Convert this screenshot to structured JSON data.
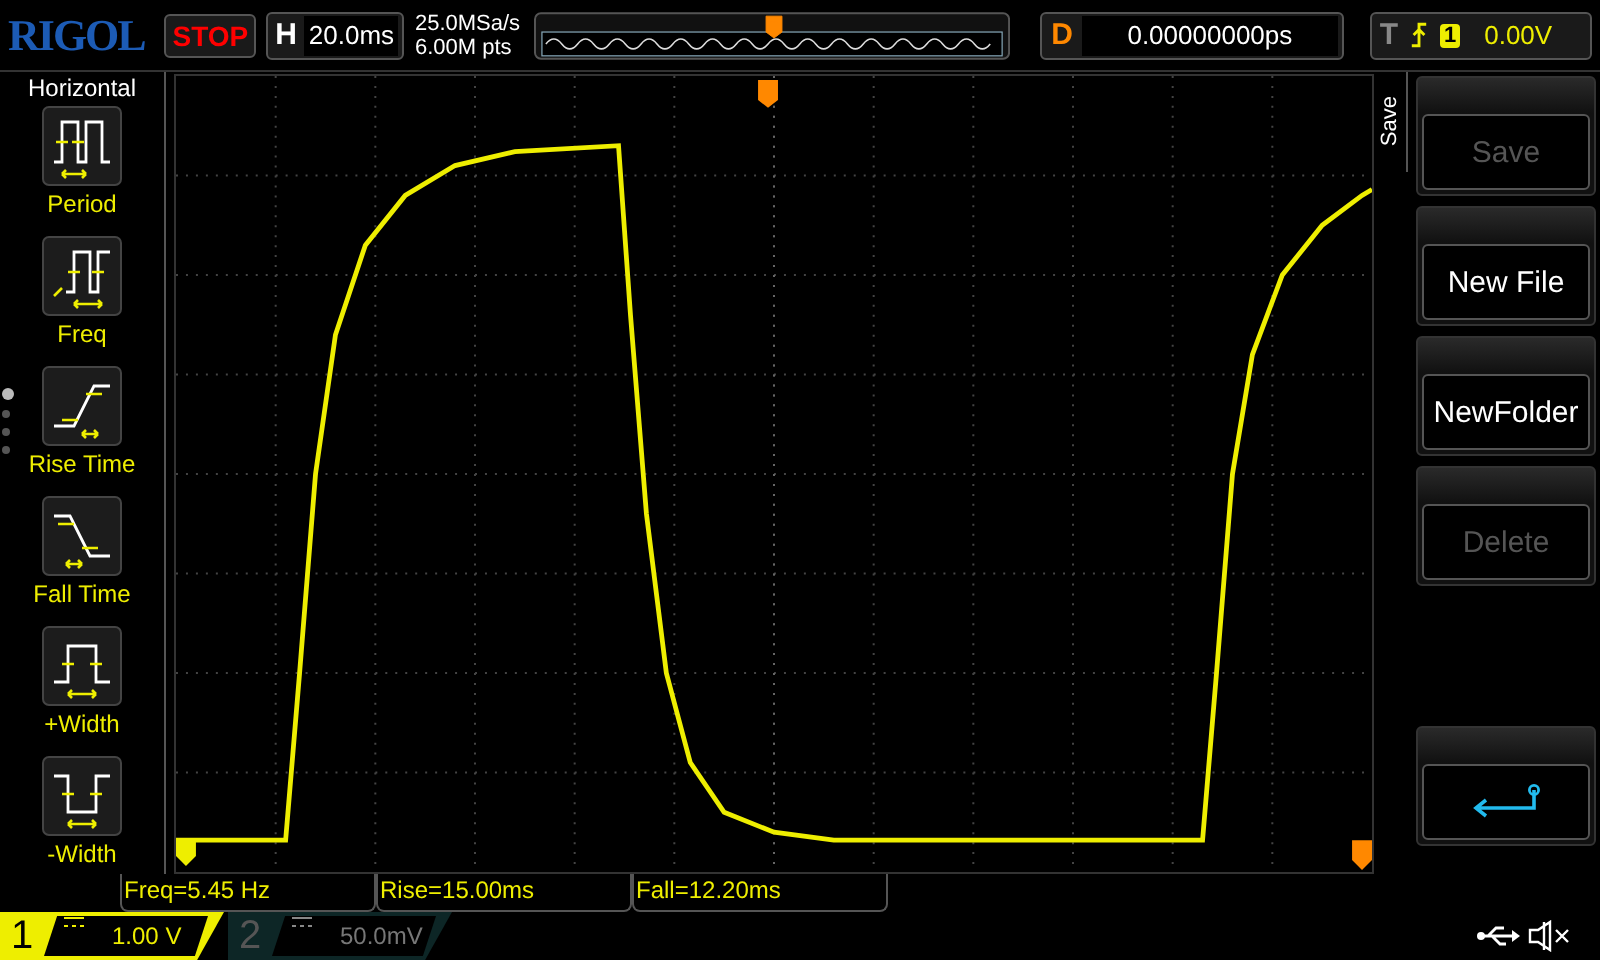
{
  "brand": "RIGOL",
  "run_state": {
    "label": "STOP",
    "running": false
  },
  "horizontal": {
    "label": "H",
    "timebase": "20.0ms"
  },
  "acquisition": {
    "sample_rate": "25.0MSa/s",
    "memory_depth": "6.00M pts"
  },
  "delay": {
    "label": "D",
    "value": "0.00000000ps"
  },
  "trigger": {
    "label": "T",
    "channel": "1",
    "level": "0.00V"
  },
  "left_menu": {
    "title": "Horizontal",
    "pages": [
      {
        "selected": true
      },
      {
        "selected": false
      },
      {
        "selected": false
      },
      {
        "selected": false
      }
    ],
    "items": [
      {
        "label": "Period",
        "kind": "period"
      },
      {
        "label": "Freq",
        "kind": "freq"
      },
      {
        "label": "Rise Time",
        "kind": "rise"
      },
      {
        "label": "Fall Time",
        "kind": "fall"
      },
      {
        "label": "+Width",
        "kind": "pwidth"
      },
      {
        "label": "-Width",
        "kind": "nwidth"
      }
    ]
  },
  "right_menu": {
    "title": "Save",
    "items": [
      {
        "kind": "text",
        "label": "Save",
        "disabled": true
      },
      {
        "kind": "text",
        "label": "New File",
        "disabled": false
      },
      {
        "kind": "text",
        "label": "NewFolder",
        "disabled": false
      },
      {
        "kind": "text",
        "label": "Delete",
        "disabled": true
      },
      {
        "kind": "gap"
      },
      {
        "kind": "back"
      }
    ]
  },
  "measurements": [
    "Freq=5.45 Hz",
    "Rise=15.00ms",
    "Fall=12.20ms"
  ],
  "channels": [
    {
      "number": "1",
      "scale": "1.00 V",
      "on": true
    },
    {
      "number": "2",
      "scale": "50.0mV",
      "on": false
    }
  ]
}
